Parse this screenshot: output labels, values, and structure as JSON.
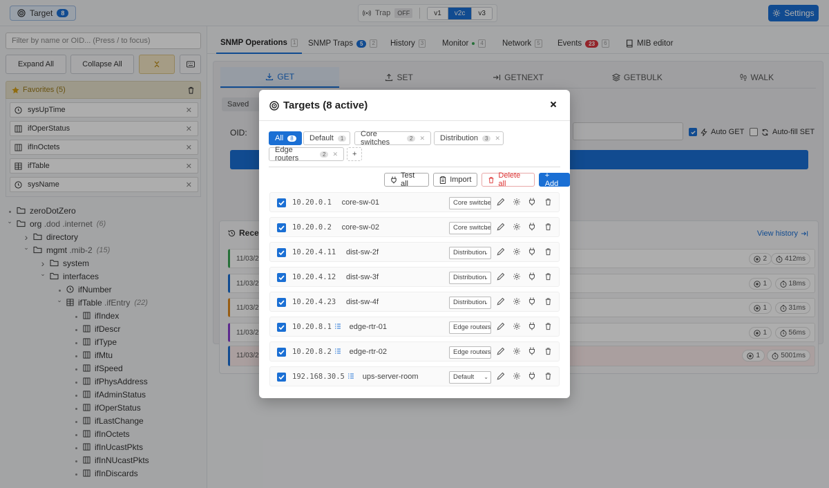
{
  "topbar": {
    "target_label": "Target",
    "target_count": "8",
    "trap_label": "Trap",
    "trap_state": "OFF",
    "versions": [
      "v1",
      "v2c",
      "v3"
    ],
    "active_version": "v2c",
    "settings_label": "Settings"
  },
  "sidebar": {
    "filter_placeholder": "Filter by name or OID... (Press / to focus)",
    "expand_all": "Expand All",
    "collapse_all": "Collapse All",
    "favorites_title": "Favorites (5)",
    "favorites": [
      {
        "label": "sysUpTime",
        "icon": "clock-icon"
      },
      {
        "label": "ifOperStatus",
        "icon": "column-icon"
      },
      {
        "label": "ifInOctets",
        "icon": "column-icon"
      },
      {
        "label": "ifTable",
        "icon": "table-icon"
      },
      {
        "label": "sysName",
        "icon": "clock-icon"
      }
    ],
    "tree": [
      {
        "name": "zeroDotZero",
        "suffix": "",
        "count": "",
        "type": "folder",
        "depth": 0,
        "state": "leaf"
      },
      {
        "name": "org",
        "suffix": ".dod .internet",
        "count": "(6)",
        "type": "folder",
        "depth": 0,
        "state": "open"
      },
      {
        "name": "directory",
        "suffix": "",
        "count": "",
        "type": "folder",
        "depth": 1,
        "state": "closed"
      },
      {
        "name": "mgmt",
        "suffix": ".mib-2",
        "count": "(15)",
        "type": "folder",
        "depth": 1,
        "state": "open"
      },
      {
        "name": "system",
        "suffix": "",
        "count": "",
        "type": "folder",
        "depth": 2,
        "state": "closed"
      },
      {
        "name": "interfaces",
        "suffix": "",
        "count": "",
        "type": "folder",
        "depth": 2,
        "state": "open"
      },
      {
        "name": "ifNumber",
        "suffix": "",
        "count": "",
        "type": "clock",
        "depth": 3,
        "state": "leaf"
      },
      {
        "name": "ifTable",
        "suffix": ".ifEntry",
        "count": "(22)",
        "type": "table",
        "depth": 3,
        "state": "open"
      },
      {
        "name": "ifIndex",
        "suffix": "",
        "count": "",
        "type": "column",
        "depth": 4,
        "state": "leaf"
      },
      {
        "name": "ifDescr",
        "suffix": "",
        "count": "",
        "type": "column",
        "depth": 4,
        "state": "leaf"
      },
      {
        "name": "ifType",
        "suffix": "",
        "count": "",
        "type": "column",
        "depth": 4,
        "state": "leaf"
      },
      {
        "name": "ifMtu",
        "suffix": "",
        "count": "",
        "type": "column",
        "depth": 4,
        "state": "leaf"
      },
      {
        "name": "ifSpeed",
        "suffix": "",
        "count": "",
        "type": "column",
        "depth": 4,
        "state": "leaf"
      },
      {
        "name": "ifPhysAddress",
        "suffix": "",
        "count": "",
        "type": "column",
        "depth": 4,
        "state": "leaf"
      },
      {
        "name": "ifAdminStatus",
        "suffix": "",
        "count": "",
        "type": "column",
        "depth": 4,
        "state": "leaf"
      },
      {
        "name": "ifOperStatus",
        "suffix": "",
        "count": "",
        "type": "column",
        "depth": 4,
        "state": "leaf"
      },
      {
        "name": "ifLastChange",
        "suffix": "",
        "count": "",
        "type": "column",
        "depth": 4,
        "state": "leaf"
      },
      {
        "name": "ifInOctets",
        "suffix": "",
        "count": "",
        "type": "column",
        "depth": 4,
        "state": "leaf"
      },
      {
        "name": "ifInUcastPkts",
        "suffix": "",
        "count": "",
        "type": "column",
        "depth": 4,
        "state": "leaf"
      },
      {
        "name": "ifInNUcastPkts",
        "suffix": "",
        "count": "",
        "type": "column",
        "depth": 4,
        "state": "leaf"
      },
      {
        "name": "ifInDiscards",
        "suffix": "",
        "count": "",
        "type": "column",
        "depth": 4,
        "state": "leaf"
      }
    ]
  },
  "main": {
    "tabs": [
      {
        "label": "SNMP Operations",
        "key": "1",
        "badge": "",
        "active": true
      },
      {
        "label": "SNMP Traps",
        "key": "2",
        "badge": "5",
        "active": false
      },
      {
        "label": "History",
        "key": "3",
        "badge": "",
        "active": false
      },
      {
        "label": "Monitor",
        "key": "4",
        "badge": "",
        "active": false
      },
      {
        "label": "Network",
        "key": "5",
        "badge": "",
        "active": false
      },
      {
        "label": "Events",
        "key": "6",
        "badge": "23",
        "active": false
      },
      {
        "label": "MIB editor",
        "key": "",
        "badge": "",
        "active": false
      }
    ],
    "ops": [
      {
        "label": "GET",
        "icon": "download-icon"
      },
      {
        "label": "SET",
        "icon": "upload-icon"
      },
      {
        "label": "GETNEXT",
        "icon": "arrow-right-icon"
      },
      {
        "label": "GETBULK",
        "icon": "layers-icon"
      },
      {
        "label": "WALK",
        "icon": "footprints-icon"
      }
    ],
    "saved_queries": "Saved Queries",
    "oid_label": "OID:",
    "auto_get": "Auto GET",
    "auto_fill_set": "Auto-fill SET",
    "recent_title": "Recent",
    "view_history": "View history",
    "history_rows": [
      {
        "date": "11/03/2",
        "count": "2",
        "time": "412ms",
        "color": "#3aa655",
        "error": false
      },
      {
        "date": "11/03/2",
        "count": "1",
        "time": "18ms",
        "color": "#1a6fd4",
        "error": false
      },
      {
        "date": "11/03/2",
        "count": "1",
        "time": "31ms",
        "color": "#e08a1e",
        "error": false
      },
      {
        "date": "11/03/2",
        "count": "1",
        "time": "56ms",
        "color": "#8a3fd1",
        "error": false
      },
      {
        "date": "11/03/2",
        "count": "1",
        "time": "5001ms",
        "color": "#1a6fd4",
        "error": true
      }
    ]
  },
  "modal": {
    "title": "Targets (8 active)",
    "groups": [
      {
        "label": "All",
        "count": "8",
        "active": true,
        "closable": false
      },
      {
        "label": "Default",
        "count": "1",
        "active": false,
        "closable": false
      },
      {
        "label": "Core switches",
        "count": "2",
        "active": false,
        "closable": true
      },
      {
        "label": "Distribution",
        "count": "3",
        "active": false,
        "closable": true
      },
      {
        "label": "Edge routers",
        "count": "2",
        "active": false,
        "closable": true
      }
    ],
    "add_group_label": "+",
    "test_all": "Test all",
    "import": "Import",
    "delete_all": "Delete all",
    "add": "+ Add",
    "targets": [
      {
        "ip": "10.20.0.1",
        "name": "core-sw-01",
        "group": "Core switches",
        "list": false
      },
      {
        "ip": "10.20.0.2",
        "name": "core-sw-02",
        "group": "Core switches",
        "list": false
      },
      {
        "ip": "10.20.4.11",
        "name": "dist-sw-2f",
        "group": "Distribution",
        "list": false
      },
      {
        "ip": "10.20.4.12",
        "name": "dist-sw-3f",
        "group": "Distribution",
        "list": false
      },
      {
        "ip": "10.20.4.23",
        "name": "dist-sw-4f",
        "group": "Distribution",
        "list": false
      },
      {
        "ip": "10.20.8.1",
        "name": "edge-rtr-01",
        "group": "Edge routers",
        "list": true
      },
      {
        "ip": "10.20.8.2",
        "name": "edge-rtr-02",
        "group": "Edge routers",
        "list": true
      },
      {
        "ip": "192.168.30.5",
        "name": "ups-server-room",
        "group": "Default",
        "list": true
      }
    ]
  }
}
